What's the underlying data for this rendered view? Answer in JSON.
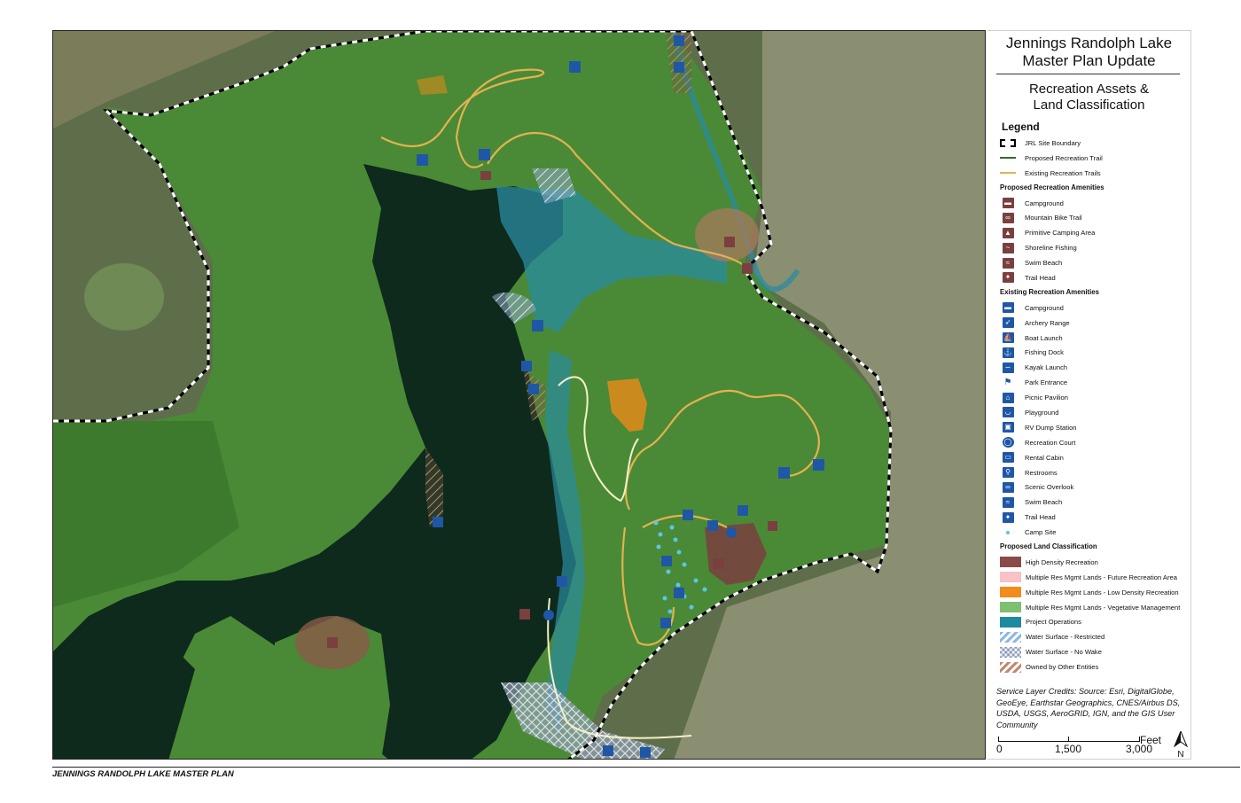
{
  "title": {
    "line1": "Jennings Randolph Lake",
    "line2": "Master Plan Update"
  },
  "subtitle": {
    "line1": "Recreation Assets &",
    "line2": "Land Classification"
  },
  "legend": {
    "title": "Legend",
    "lines": [
      {
        "label": "JRL Site Boundary",
        "style": "dashed",
        "color": "#000000"
      },
      {
        "label": "Proposed Recreation Trail",
        "style": "solid",
        "color": "#2e6b2e"
      },
      {
        "label": "Existing Recreation Trails",
        "style": "solid",
        "color": "#e3b24f"
      }
    ],
    "proposed_heading": "Proposed Recreation Amenities",
    "proposed": [
      {
        "label": "Campground",
        "icon": "camper-icon",
        "glyph": "▬"
      },
      {
        "label": "Mountain Bike Trail",
        "icon": "bike-icon",
        "glyph": "∞"
      },
      {
        "label": "Primitive Camping Area",
        "icon": "tent-icon",
        "glyph": "▲"
      },
      {
        "label": "Shoreline Fishing",
        "icon": "fishing-icon",
        "glyph": "~"
      },
      {
        "label": "Swim Beach",
        "icon": "swimmer-icon",
        "glyph": "≈"
      },
      {
        "label": "Trail Head",
        "icon": "hiker-icon",
        "glyph": "✦"
      }
    ],
    "existing_heading": "Existing Recreation Amenities",
    "existing": [
      {
        "label": "Campground",
        "icon": "camper-icon",
        "glyph": "▬"
      },
      {
        "label": "Archery Range",
        "icon": "archery-icon",
        "glyph": "➶"
      },
      {
        "label": "Boat Launch",
        "icon": "boat-launch-icon",
        "glyph": "⛵"
      },
      {
        "label": "Fishing Dock",
        "icon": "fishing-dock-icon",
        "glyph": "⚓"
      },
      {
        "label": "Kayak Launch",
        "icon": "kayak-icon",
        "glyph": "∽"
      },
      {
        "label": "Park Entrance",
        "icon": "flag-icon",
        "glyph": "⚑",
        "plain": true
      },
      {
        "label": "Picnic Pavilion",
        "icon": "pavilion-icon",
        "glyph": "⌂"
      },
      {
        "label": "Playground",
        "icon": "playground-icon",
        "glyph": "◡"
      },
      {
        "label": "RV Dump Station",
        "icon": "rv-icon",
        "glyph": "▣"
      },
      {
        "label": "Recreation Court",
        "icon": "court-icon",
        "glyph": "◯",
        "round": true
      },
      {
        "label": "Rental Cabin",
        "icon": "cabin-icon",
        "glyph": "▭"
      },
      {
        "label": "Restrooms",
        "icon": "restroom-icon",
        "glyph": "⚲"
      },
      {
        "label": "Scenic Overlook",
        "icon": "binoculars-icon",
        "glyph": "∞"
      },
      {
        "label": "Swim Beach",
        "icon": "swimmer-icon",
        "glyph": "≈"
      },
      {
        "label": "Trail Head",
        "icon": "hiker-icon",
        "glyph": "✦"
      },
      {
        "label": "Camp Site",
        "icon": "camp-site-dot-icon",
        "glyph": "•",
        "dot": true
      }
    ],
    "land_heading": "Proposed Land Classification",
    "land": [
      {
        "label": "High Density Recreation",
        "color": "#8a4a4a",
        "pattern": "solid"
      },
      {
        "label": "Multiple Res Mgmt Lands - Future Recreation Area",
        "color": "#f7c2c8",
        "pattern": "solid"
      },
      {
        "label": "Multiple Res Mgmt Lands - Low Density Recreation",
        "color": "#f28c1b",
        "pattern": "solid"
      },
      {
        "label": "Multiple Res Mgmt Lands - Vegetative Management",
        "color": "#7fbf72",
        "pattern": "solid"
      },
      {
        "label": "Project Operations",
        "color": "#1d8aa0",
        "pattern": "solid"
      },
      {
        "label": "Water Surface - Restricted",
        "color": "#8fb8e0",
        "pattern": "hatch"
      },
      {
        "label": "Water Surface - No Wake",
        "color": "#b9c4d4",
        "pattern": "cross"
      },
      {
        "label": "Owned by Other Entities",
        "color": "#c08a70",
        "pattern": "hatch"
      }
    ]
  },
  "credits": "Service Layer Credits: Source: Esri, DigitalGlobe, GeoEye, Earthstar Geographics, CNES/Airbus DS, USDA, USGS, AeroGRID, IGN, and the GIS User Community",
  "scale": {
    "labels": [
      "0",
      "1,500",
      "3,000"
    ],
    "unit": "Feet",
    "north": "N"
  },
  "footer": "JENNINGS RANDOLPH LAKE MASTER PLAN",
  "colors": {
    "forest": "#3f7a2f",
    "vegetative": "#4a8a36",
    "water": "#0e2a1c",
    "project_ops": "#2a8ba0",
    "high_density": "#7a3f3f",
    "low_density": "#d98a1c",
    "trail": "#e3b24f",
    "proposed_trail": "#f4f0c8",
    "amenity_blue": "#1f57a6",
    "amenity_brown": "#7a3f3f"
  }
}
